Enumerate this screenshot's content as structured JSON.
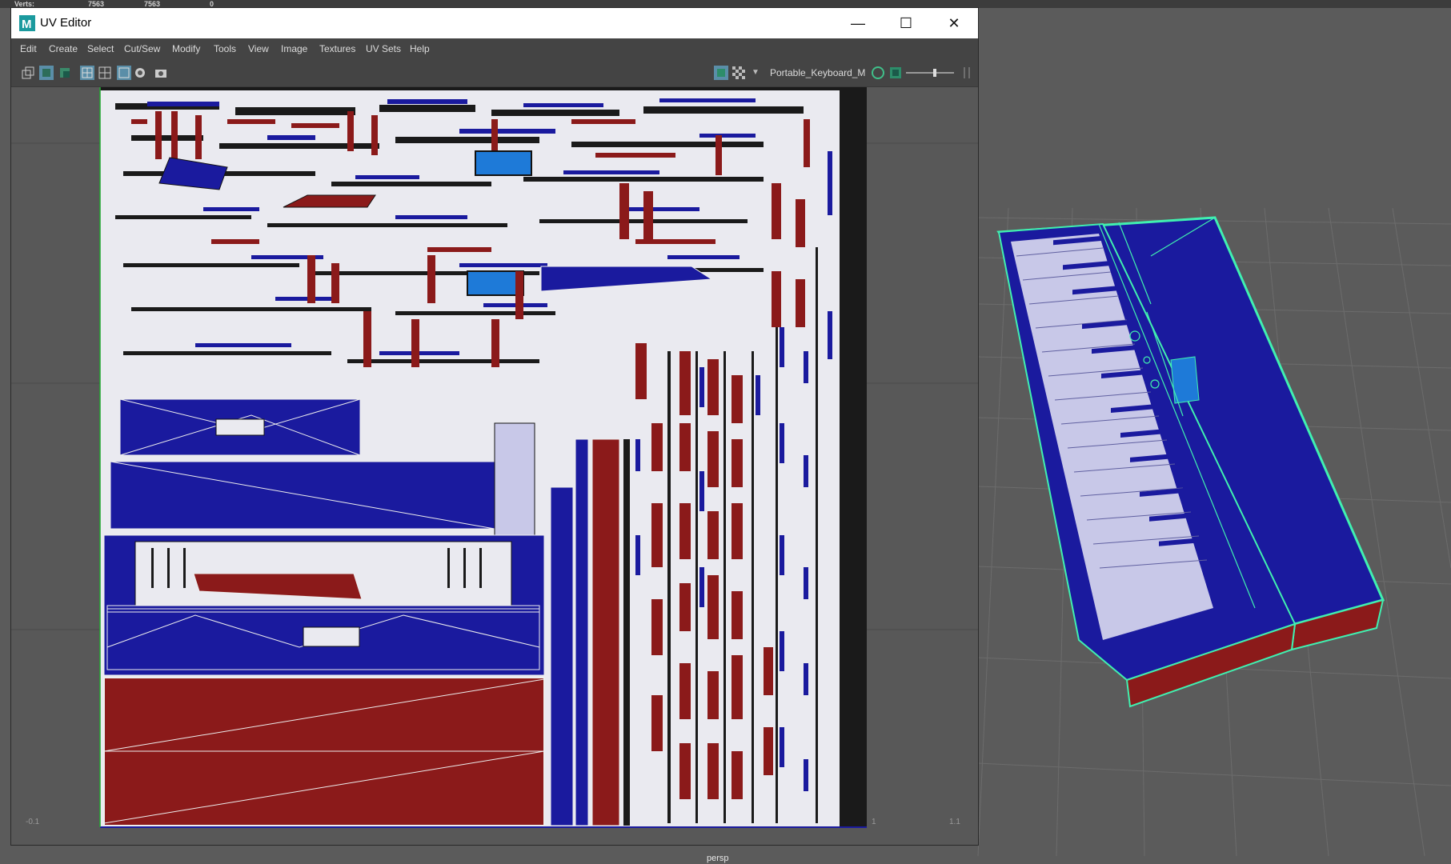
{
  "hud": {
    "label": "Verts:",
    "values": [
      "7563",
      "7563",
      "0"
    ]
  },
  "viewport": {
    "camera_label": "persp"
  },
  "window": {
    "title": "UV Editor",
    "controls": {
      "minimize": "—",
      "maximize": "☐",
      "close": "✕"
    }
  },
  "menu": [
    "Edit",
    "Create",
    "Select",
    "Cut/Sew",
    "Modify",
    "Tools",
    "View",
    "Image",
    "Textures",
    "UV Sets",
    "Help"
  ],
  "toolbar": {
    "uv_set": "Portable_Keyboard_M"
  },
  "canvas": {
    "axis_left": "-0.1",
    "axis_mid": "1",
    "axis_right": "1.1"
  },
  "colors": {
    "uv_blue": "#1a1a9e",
    "uv_red": "#8b1a1a",
    "uv_white": "#e8e8ee",
    "wire_green": "#40f0b0",
    "ui_panel": "#444444",
    "viewport_bg": "#5b5b5b"
  }
}
